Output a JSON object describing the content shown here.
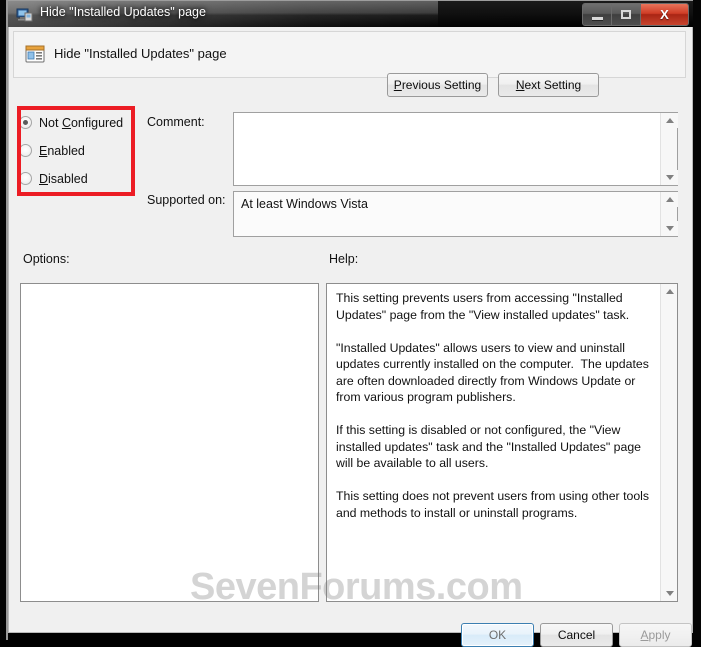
{
  "window": {
    "title": "Hide \"Installed Updates\" page",
    "icon": "computer-policy-icon",
    "caption_buttons": {
      "minimize": "–",
      "maximize": "□",
      "close": "X"
    }
  },
  "header": {
    "icon": "policy-setting-icon",
    "title": "Hide \"Installed Updates\" page",
    "previous_button": "Previous Setting",
    "previous_accel": "P",
    "next_button": "Next Setting",
    "next_accel": "N"
  },
  "state": {
    "selected": "Not Configured",
    "options": [
      {
        "label": "Not Configured",
        "accel": "C",
        "pre": "Not ",
        "post": "onfigured",
        "checked": true
      },
      {
        "label": "Enabled",
        "accel": "E",
        "pre": "",
        "post": "nabled",
        "checked": false
      },
      {
        "label": "Disabled",
        "accel": "D",
        "pre": "",
        "post": "isabled",
        "checked": false
      }
    ]
  },
  "comment": {
    "label": "Comment:",
    "value": "",
    "placeholder": ""
  },
  "supported": {
    "label": "Supported on:",
    "value": "At least Windows Vista"
  },
  "panels": {
    "options_label": "Options:",
    "help_label": "Help:",
    "options_content": "",
    "help_text": "This setting prevents users from accessing \"Installed Updates\" page from the \"View installed updates\" task.\n\n\"Installed Updates\" allows users to view and uninstall updates currently installed on the computer.  The updates are often downloaded directly from Windows Update or from various program publishers.\n\nIf this setting is disabled or not configured, the \"View installed updates\" task and the \"Installed Updates\" page will be available to all users.\n\nThis setting does not prevent users from using other tools and methods to install or uninstall programs."
  },
  "footer": {
    "ok": "OK",
    "cancel": "Cancel",
    "apply": "Apply",
    "apply_accel": "A",
    "apply_disabled": true,
    "ok_is_default": true
  },
  "watermark": "SevenForums.com",
  "colors": {
    "annotation": "#ec1c24",
    "close_button": "#c9452e",
    "default_button_border": "#3c7fb1",
    "client_background": "#f0f0f0",
    "field_background": "#ffffff"
  }
}
